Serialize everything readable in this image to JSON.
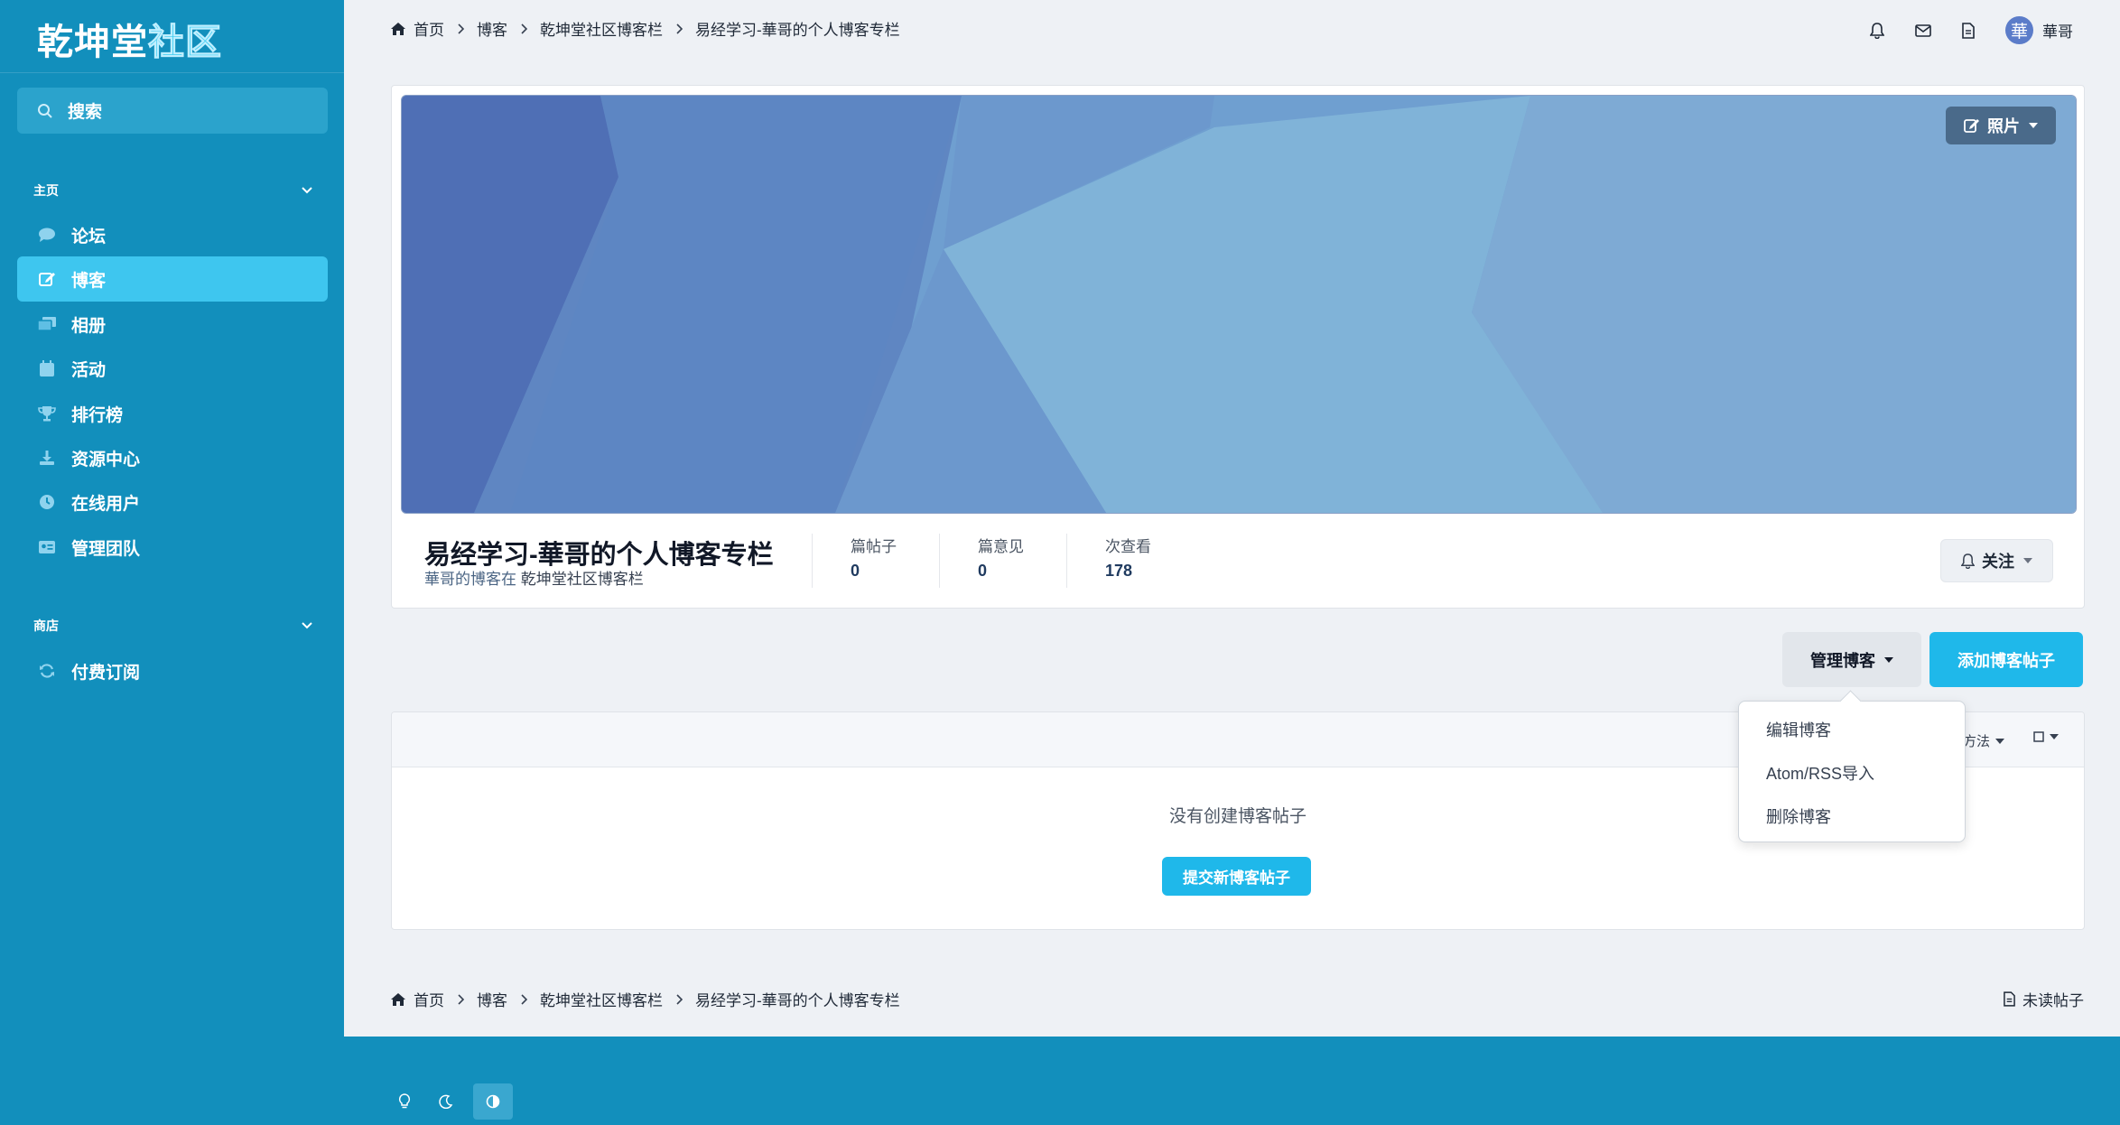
{
  "sidebar": {
    "logo_white": "乾坤堂",
    "logo_cyan": "社区",
    "search_label": "搜索",
    "section_main": "主页",
    "items": [
      {
        "label": "论坛",
        "icon": "chat-icon"
      },
      {
        "label": "博客",
        "icon": "edit-icon"
      },
      {
        "label": "相册",
        "icon": "gallery-icon"
      },
      {
        "label": "活动",
        "icon": "calendar-icon"
      },
      {
        "label": "排行榜",
        "icon": "trophy-icon"
      },
      {
        "label": "资源中心",
        "icon": "download-icon"
      },
      {
        "label": "在线用户",
        "icon": "clock-icon"
      },
      {
        "label": "管理团队",
        "icon": "id-card-icon"
      }
    ],
    "section_shop": "商店",
    "shop_items": [
      {
        "label": "付费订阅",
        "icon": "refresh-icon"
      }
    ]
  },
  "breadcrumb": {
    "items": [
      "首页",
      "博客",
      "乾坤堂社区博客栏",
      "易经学习-華哥的个人博客专栏"
    ]
  },
  "topbar": {
    "avatar_char": "華",
    "username": "華哥"
  },
  "blog": {
    "photo_button": "照片",
    "title": "易经学习-華哥的个人博客专栏",
    "sub_owner": "華哥的博客在",
    "sub_location": "乾坤堂社区博客栏",
    "stats": [
      {
        "label": "篇帖子",
        "value": "0"
      },
      {
        "label": "篇意见",
        "value": "0"
      },
      {
        "label": "次查看",
        "value": "178"
      }
    ],
    "follow_button": "关注"
  },
  "actions": {
    "manage": "管理博客",
    "add": "添加博客帖子"
  },
  "dropdown": {
    "items": [
      "编辑博客",
      "Atom/RSS导入",
      "删除博客"
    ]
  },
  "panel": {
    "sort_label": "方法",
    "empty_text": "没有创建博客帖子",
    "submit_button": "提交新博客帖子"
  },
  "footer": {
    "unread": "未读帖子"
  },
  "colors": {
    "sidebar": "#128fbc",
    "active_nav": "#3ec6ef",
    "primary_button": "#1fb8ea"
  }
}
